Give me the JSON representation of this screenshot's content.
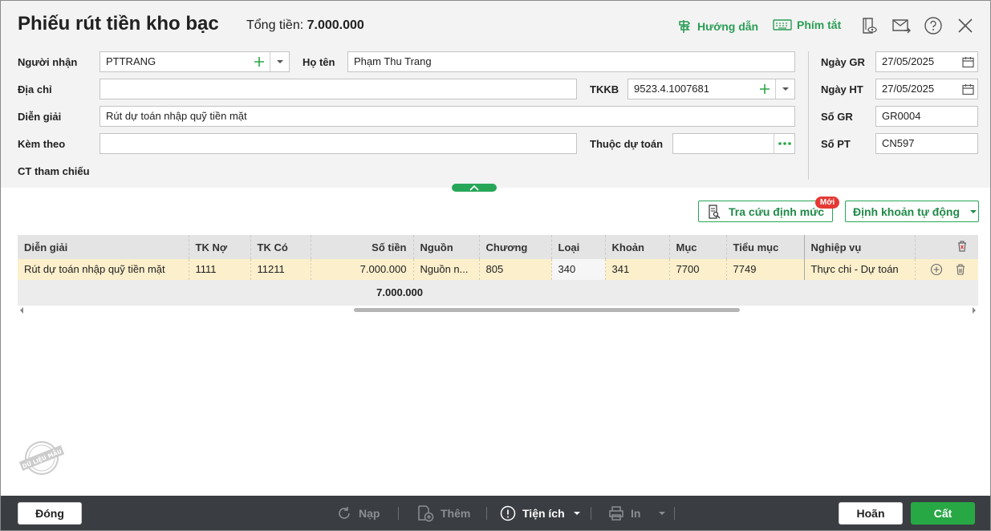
{
  "header": {
    "title": "Phiếu rút tiền kho bạc",
    "total_label": "Tổng tiền:",
    "total_value": "7.000.000",
    "guide_label": "Hướng dẫn",
    "shortcut_label": "Phím tắt"
  },
  "form": {
    "recipient_label": "Người nhận",
    "recipient_value": "PTTRANG",
    "fullname_label": "Họ tên",
    "fullname_value": "Phạm Thu Trang",
    "address_label": "Địa chỉ",
    "address_value": "",
    "tkkb_label": "TKKB",
    "tkkb_value": "9523.4.1007681",
    "description_label": "Diễn giải",
    "description_value": "Rút dự toán nhập quỹ tiền mặt",
    "attach_label": "Kèm theo",
    "attach_value": "",
    "budget_label": "Thuộc dự toán",
    "budget_value": "",
    "ref_label": "CT tham chiếu",
    "date_gr_label": "Ngày GR",
    "date_gr_value": "27/05/2025",
    "date_ht_label": "Ngày HT",
    "date_ht_value": "27/05/2025",
    "so_gr_label": "Số GR",
    "so_gr_value": "GR0004",
    "so_pt_label": "Số PT",
    "so_pt_value": "CN597"
  },
  "actions": {
    "lookup_label": "Tra cứu định mức",
    "new_badge": "Mới",
    "auto_label": "Định khoản tự động"
  },
  "grid": {
    "columns": [
      "Diễn giải",
      "TK Nợ",
      "TK Có",
      "Số tiền",
      "Nguồn",
      "Chương",
      "Loại",
      "Khoản",
      "Mục",
      "Tiểu mục",
      "Nghiệp vụ"
    ],
    "rows": [
      [
        "Rút dự toán nhập quỹ tiền mặt",
        "1111",
        "11211",
        "7.000.000",
        "Nguồn n...",
        "805",
        "340",
        "341",
        "7700",
        "7749",
        "Thực chi - Dự toán"
      ]
    ],
    "total": "7.000.000"
  },
  "stamp_text": "DỮ LIỆU MẪU",
  "footer": {
    "close_label": "Đóng",
    "reload_label": "Nạp",
    "add_label": "Thêm",
    "utility_label": "Tiện ích",
    "print_label": "In",
    "cancel_label": "Hoãn",
    "save_label": "Cất"
  },
  "colors": {
    "accent_green": "#28a745",
    "row_highlight": "#fcefcc",
    "footer_bg": "#3a3d42",
    "badge_red": "#e53935"
  }
}
